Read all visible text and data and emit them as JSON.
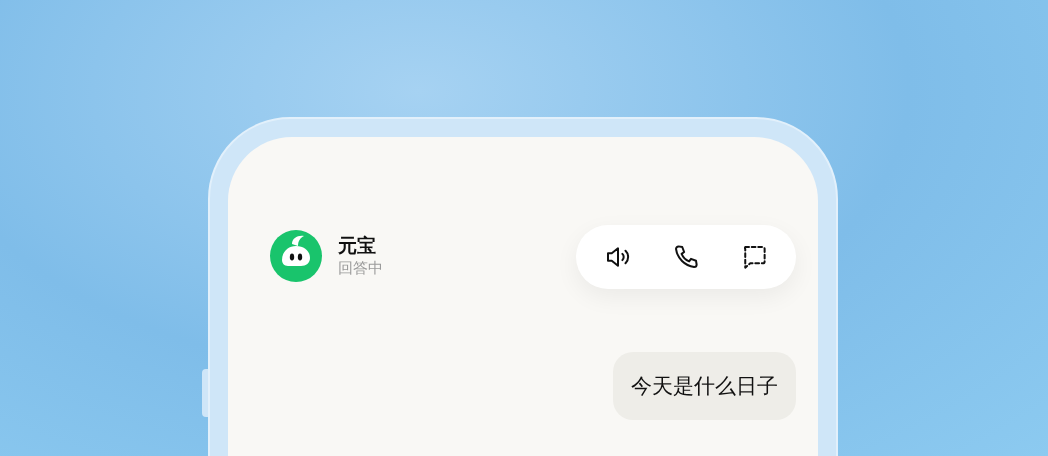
{
  "chat_header": {
    "name": "元宝",
    "status": "回答中"
  },
  "actions": [
    {
      "kind": "speaker"
    },
    {
      "kind": "phone"
    },
    {
      "kind": "chat"
    }
  ],
  "messages": [
    {
      "kind": "outgoing",
      "text": "今天是什么日子"
    }
  ]
}
